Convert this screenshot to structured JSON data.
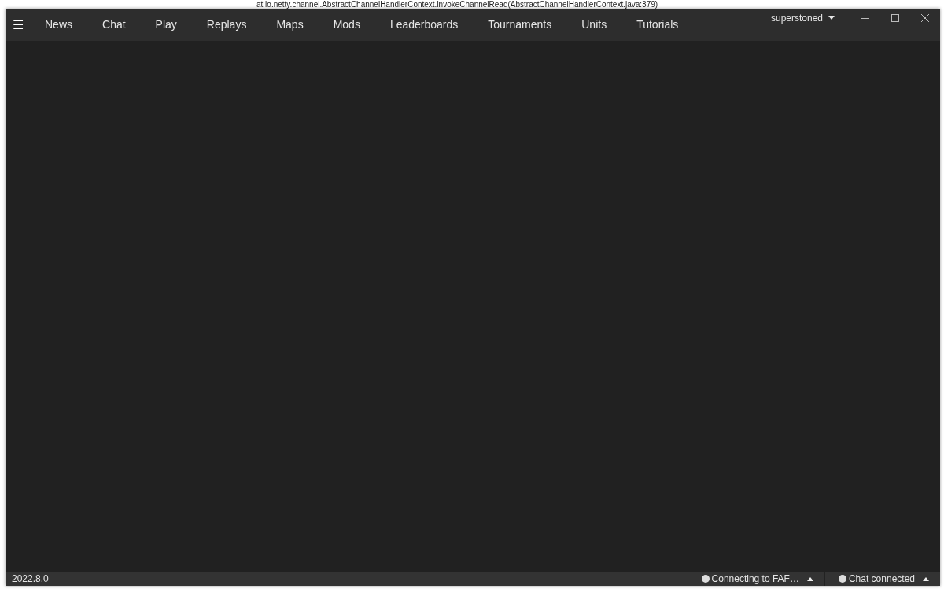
{
  "background_log_line": "at io.netty.channel.AbstractChannelHandlerContext.invokeChannelRead(AbstractChannelHandlerContext.java:379)",
  "menu_button": "☰",
  "tabs": [
    {
      "label": "News",
      "selected": false
    },
    {
      "label": "Chat",
      "selected": false
    },
    {
      "label": "Play",
      "selected": false
    },
    {
      "label": "Replays",
      "selected": false
    },
    {
      "label": "Maps",
      "selected": false
    },
    {
      "label": "Mods",
      "selected": false
    },
    {
      "label": "Leaderboards",
      "selected": false
    },
    {
      "label": "Tournaments",
      "selected": false
    },
    {
      "label": "Units",
      "selected": false
    },
    {
      "label": "Tutorials",
      "selected": false
    }
  ],
  "user_menu": {
    "label": "superstoned"
  },
  "status_bar": {
    "version": "2022.8.0",
    "indicators": [
      {
        "label": "Connecting to FAF…"
      },
      {
        "label": "Chat connected"
      }
    ]
  }
}
